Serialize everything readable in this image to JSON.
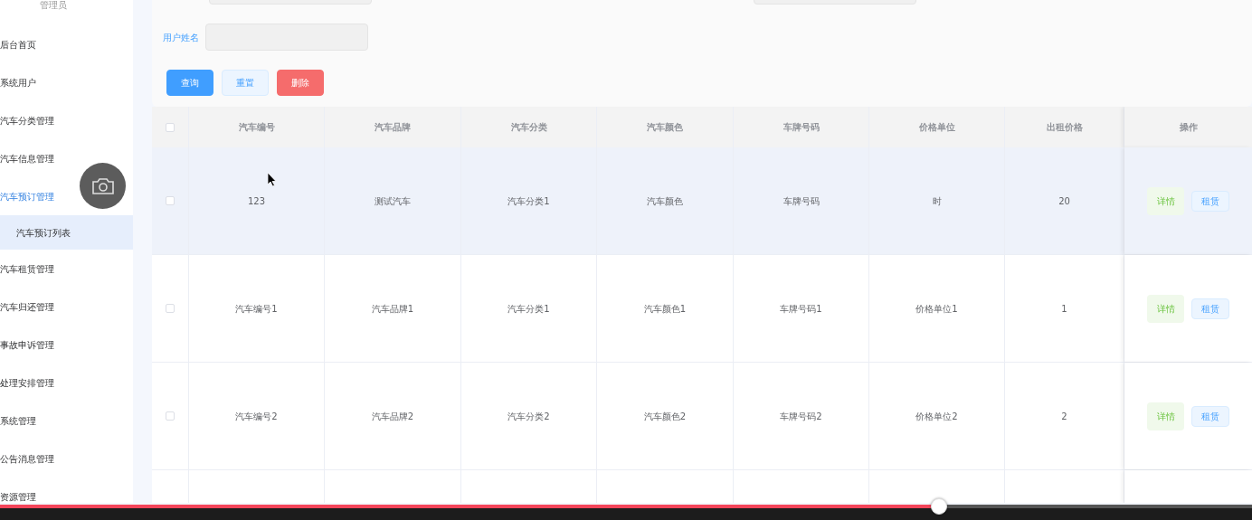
{
  "sidebar": {
    "title": "管理员",
    "items": [
      {
        "label": "后台首页",
        "selected": false,
        "expanded": false
      },
      {
        "label": "系统用户",
        "selected": false,
        "expanded": false
      },
      {
        "label": "汽车分类管理",
        "selected": false,
        "expanded": false
      },
      {
        "label": "汽车信息管理",
        "selected": false,
        "expanded": false
      },
      {
        "label": "汽车预订管理",
        "selected": false,
        "expanded": true,
        "children": [
          {
            "label": "汽车预订列表",
            "selected": true
          }
        ]
      },
      {
        "label": "汽车租赁管理",
        "selected": false,
        "expanded": false
      },
      {
        "label": "汽车归还管理",
        "selected": false,
        "expanded": false
      },
      {
        "label": "事故申诉管理",
        "selected": false,
        "expanded": false
      },
      {
        "label": "处理安排管理",
        "selected": false,
        "expanded": false
      },
      {
        "label": "系统管理",
        "selected": false,
        "expanded": false
      },
      {
        "label": "公告消息管理",
        "selected": false,
        "expanded": false
      },
      {
        "label": "资源管理",
        "selected": false,
        "expanded": false
      }
    ]
  },
  "search": {
    "label": "用户姓名",
    "buttons": [
      {
        "label": "查询",
        "kind": "primary"
      },
      {
        "label": "重置",
        "kind": "plain"
      },
      {
        "label": "删除",
        "kind": "danger"
      }
    ]
  },
  "table": {
    "all_checked": false,
    "columns": [
      "汽车编号",
      "汽车品牌",
      "汽车分类",
      "汽车颜色",
      "车牌号码",
      "价格单位",
      "出租价格",
      "操作"
    ],
    "rows": [
      {
        "cells": [
          "123",
          "测试汽车",
          "汽车分类1",
          "汽车颜色",
          "车牌号码",
          "时",
          "20"
        ],
        "hovered": true,
        "checked": false,
        "actions": [
          "详情",
          "租赁"
        ]
      },
      {
        "cells": [
          "汽车编号1",
          "汽车品牌1",
          "汽车分类1",
          "汽车颜色1",
          "车牌号码1",
          "价格单位1",
          "1"
        ],
        "hovered": false,
        "checked": false,
        "actions": [
          "详情",
          "租赁"
        ]
      },
      {
        "cells": [
          "汽车编号2",
          "汽车品牌2",
          "汽车分类2",
          "汽车颜色2",
          "车牌号码2",
          "价格单位2",
          "2"
        ],
        "hovered": false,
        "checked": false,
        "actions": [
          "详情",
          "租赁"
        ]
      }
    ]
  },
  "player": {
    "progress": {
      "level": 0.75
    }
  }
}
